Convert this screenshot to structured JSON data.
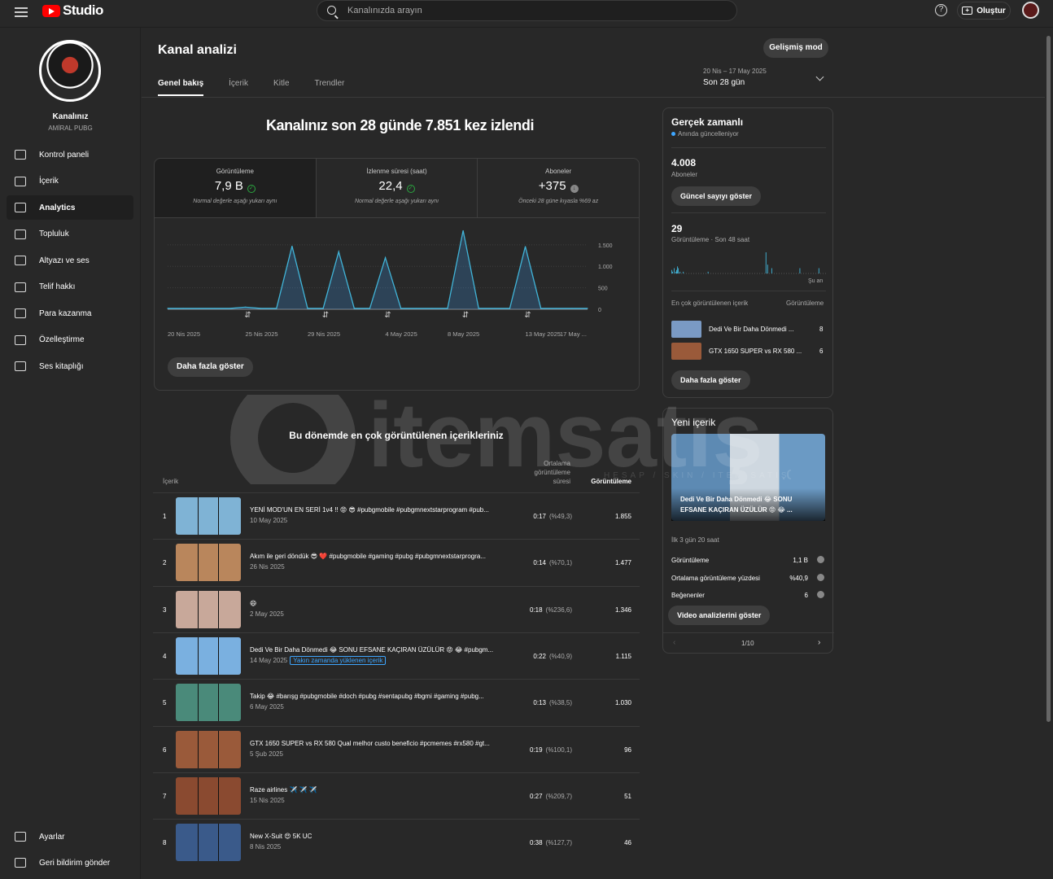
{
  "header": {
    "studio": "Studio",
    "search_placeholder": "Kanalınızda arayın",
    "create": "Oluştur"
  },
  "channel": {
    "name": "Kanalınız",
    "sub": "AMİRAL PUBG"
  },
  "nav": [
    {
      "label": "Kontrol paneli",
      "icon": "dashboard-icon"
    },
    {
      "label": "İçerik",
      "icon": "content-icon"
    },
    {
      "label": "Analytics",
      "icon": "analytics-icon",
      "active": true
    },
    {
      "label": "Topluluk",
      "icon": "community-icon"
    },
    {
      "label": "Altyazı ve ses",
      "icon": "subtitles-icon"
    },
    {
      "label": "Telif hakkı",
      "icon": "copyright-icon"
    },
    {
      "label": "Para kazanma",
      "icon": "dollar-icon"
    },
    {
      "label": "Özelleştirme",
      "icon": "wand-icon"
    },
    {
      "label": "Ses kitaplığı",
      "icon": "audio-library-icon"
    }
  ],
  "nav_bottom": [
    {
      "label": "Ayarlar",
      "icon": "gear-icon"
    },
    {
      "label": "Geri bildirim gönder",
      "icon": "feedback-icon"
    }
  ],
  "page": {
    "title": "Kanal analizi",
    "advanced": "Gelişmiş mod",
    "tabs": [
      "Genel bakış",
      "İçerik",
      "Kitle",
      "Trendler"
    ],
    "date_range": "20 Nis – 17 May 2025",
    "period": "Son 28 gün",
    "headline": "Kanalınız son 28 günde 7.851 kez izlendi"
  },
  "stats": [
    {
      "label": "Görüntüleme",
      "value": "7,9 B",
      "note": "Normal değerle aşağı yukarı aynı"
    },
    {
      "label": "İzlenme süresi (saat)",
      "value": "22,4",
      "note": "Normal değerle aşağı yukarı aynı"
    },
    {
      "label": "Aboneler",
      "value": "+375",
      "note": "Önceki 28 güne kıyasla %69 az"
    }
  ],
  "chart_data": {
    "type": "line",
    "x": [
      "20 Nis",
      "21 Nis",
      "22 Nis",
      "23 Nis",
      "24 Nis",
      "25 Nis",
      "26 Nis",
      "27 Nis",
      "28 Nis",
      "29 Nis",
      "30 Nis",
      "1 May",
      "2 May",
      "3 May",
      "4 May",
      "5 May",
      "6 May",
      "7 May",
      "8 May",
      "9 May",
      "10 May",
      "11 May",
      "12 May",
      "13 May",
      "14 May",
      "15 May",
      "16 May",
      "17 May"
    ],
    "values": [
      20,
      20,
      20,
      20,
      20,
      50,
      20,
      20,
      1470,
      20,
      20,
      1340,
      20,
      20,
      1200,
      20,
      20,
      20,
      20,
      1830,
      20,
      20,
      20,
      1460,
      20,
      20,
      20,
      20
    ],
    "yticks": [
      "1.500",
      "1.000",
      "500",
      "0"
    ],
    "ylim": [
      0,
      1800
    ],
    "xticks": [
      "20 Nis 2025",
      "25 Nis 2025",
      "29 Nis 2025",
      "4 May 2025",
      "8 May 2025",
      "13 May 2025",
      "17 May ..."
    ]
  },
  "more": "Daha fazla göster",
  "top_content": {
    "title": "Bu dönemde en çok görüntülenen içerikleriniz",
    "col_content": "İçerik",
    "col_avg": "Ortalama görüntüleme süresi",
    "col_views": "Görüntüleme",
    "rows": [
      {
        "rank": "1",
        "title": "YENİ MOD'UN EN SERİ 1v4 !! 😡 😎 #pubgmobile #pubgmnextstarprogram #pub...",
        "date": "10 May 2025",
        "dur": "0:17",
        "pct": "(%49,3)",
        "views": "1.855",
        "thumb": "#7fb3d5"
      },
      {
        "rank": "2",
        "title": "Akım ile geri döndük 😎 ❤️ #pubgmobile #gaming #pubg #pubgmnextstarprogra...",
        "date": "26 Nis 2025",
        "dur": "0:14",
        "pct": "(%70,1)",
        "views": "1.477",
        "thumb": "#b9865c"
      },
      {
        "rank": "3",
        "title": "😄",
        "date": "2 May 2025",
        "dur": "0:18",
        "pct": "(%236,6)",
        "views": "1.346",
        "thumb": "#c8a89a"
      },
      {
        "rank": "4",
        "title": "Dedi Ve Bir Daha Dönmedi 😂 SONU EFSANE KAÇIRAN ÜZÜLÜR 😡 😂 #pubgm...",
        "date": "14 May 2025",
        "badge": "Yakın zamanda yüklenen içerik",
        "dur": "0:22",
        "pct": "(%40,9)",
        "views": "1.115",
        "thumb": "#7ab0e0"
      },
      {
        "rank": "5",
        "title": "Takip 😂 #barışg #pubgmobile #doch #pubg #sentapubg #bgmi #gaming #pubg...",
        "date": "6 May 2025",
        "dur": "0:13",
        "pct": "(%38,5)",
        "views": "1.030",
        "thumb": "#4a8a7a"
      },
      {
        "rank": "6",
        "title": "GTX 1650 SUPER vs RX 580 Qual melhor custo beneficio #pcmemes #rx580 #gt...",
        "date": "5 Şub 2025",
        "dur": "0:19",
        "pct": "(%100,1)",
        "views": "96",
        "thumb": "#9a5a3a"
      },
      {
        "rank": "7",
        "title": "Raze airlines ✈️ ✈️ ✈️",
        "date": "15 Nis 2025",
        "dur": "0:27",
        "pct": "(%209,7)",
        "views": "51",
        "thumb": "#8a4a30"
      },
      {
        "rank": "8",
        "title": "New X-Suit 😍 5K UC",
        "date": "8 Nis 2025",
        "dur": "0:38",
        "pct": "(%127,7)",
        "views": "46",
        "thumb": "#3a5a8a"
      }
    ]
  },
  "realtime": {
    "title": "Gerçek zamanlı",
    "live": "Anında güncelleniyor",
    "subs": "4.008",
    "subs_label": "Aboneler",
    "show_count": "Güncel sayıyı göster",
    "views": "29",
    "views_label": "Görüntüleme · Son 48 saat",
    "now": "Şu an",
    "top_label": "En çok görüntülenen içerik",
    "top_views_label": "Görüntüleme",
    "items": [
      {
        "title": "Dedi Ve Bir Daha Dönmedi ...",
        "views": "8"
      },
      {
        "title": "GTX 1650 SUPER vs RX 580 ...",
        "views": "6"
      }
    ],
    "bars": [
      2,
      1,
      0,
      3,
      0,
      1,
      2,
      4,
      3,
      0,
      1,
      0,
      0,
      0,
      1,
      0,
      0,
      0,
      0,
      0,
      0,
      0,
      0,
      0,
      0,
      0,
      0,
      0,
      0,
      0,
      0,
      0,
      0,
      0,
      0,
      0,
      0,
      0,
      0,
      0,
      0,
      0,
      0,
      0,
      1,
      0,
      0,
      0,
      0,
      0,
      0,
      0,
      0,
      0,
      0,
      0,
      0,
      0,
      0,
      0,
      0,
      0,
      0,
      0,
      0,
      0,
      0,
      0,
      0,
      0,
      0,
      0,
      0,
      0,
      0,
      0,
      0,
      0,
      0,
      0,
      0,
      0,
      0,
      0,
      0,
      0,
      0,
      0,
      0,
      0,
      0,
      0,
      0,
      0,
      0,
      0,
      0,
      0,
      0,
      0,
      0,
      0,
      0,
      0,
      0,
      0,
      0,
      0,
      0,
      0,
      0,
      0,
      0,
      0,
      12,
      0,
      5,
      0,
      0,
      0,
      0,
      3,
      0,
      0,
      0,
      0,
      0,
      0,
      0,
      0,
      0,
      0,
      0,
      0,
      0,
      0,
      0,
      0,
      0,
      0,
      0,
      0,
      0,
      0,
      0,
      0,
      0,
      0,
      0,
      0,
      0,
      0,
      0,
      0,
      0,
      3,
      0,
      0,
      0,
      0,
      0,
      0,
      0,
      0,
      0,
      0,
      0,
      0,
      0,
      0,
      0,
      0,
      0,
      0,
      0,
      0,
      0,
      0,
      3,
      0,
      0,
      0,
      0,
      0,
      0,
      0,
      0
    ]
  },
  "new_content": {
    "title": "Yeni içerik",
    "video_title": "Dedi Ve Bir Daha Dönmedi 😂 SONU EFSANE KAÇIRAN ÜZÜLÜR 😡 😂 ...",
    "age": "İlk 3 gün 20 saat",
    "metrics": [
      {
        "label": "Görüntüleme",
        "value": "1,1 B"
      },
      {
        "label": "Ortalama görüntüleme yüzdesi",
        "value": "%40,9"
      },
      {
        "label": "Beğenenler",
        "value": "6"
      }
    ],
    "button": "Video analizlerini göster",
    "pager": "1/10"
  },
  "watermark": {
    "text": "itemsatış",
    "sub": "HESAP / SKIN / ITEM SATIŞ",
    "com": ".com"
  }
}
